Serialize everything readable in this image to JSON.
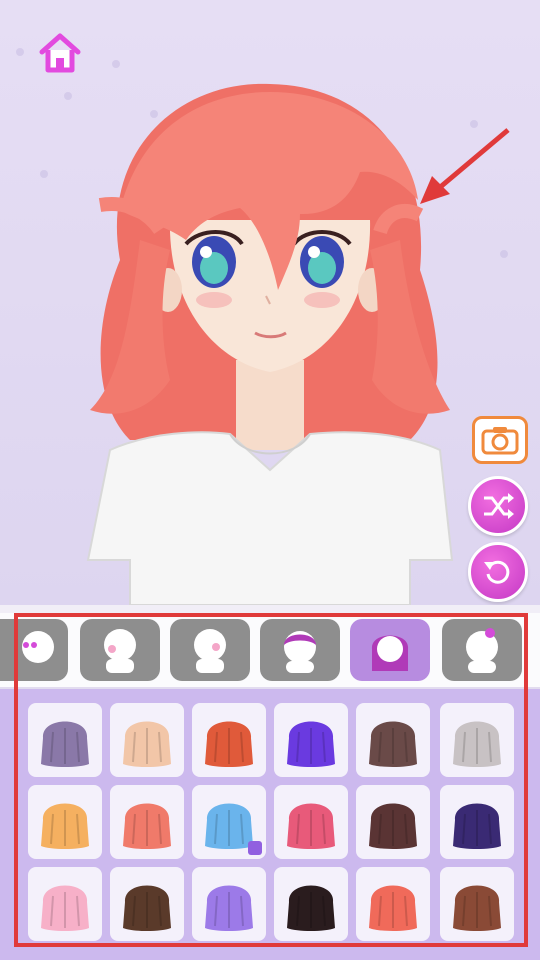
{
  "screen": {
    "home_button": {
      "icon": "home-icon"
    },
    "side_buttons": [
      {
        "name": "camera-button",
        "icon": "camera-icon"
      },
      {
        "name": "shuffle-button",
        "icon": "shuffle-icon"
      },
      {
        "name": "reset-button",
        "icon": "reset-icon"
      }
    ]
  },
  "category_tabs": [
    {
      "name": "tab-eyes",
      "active": false
    },
    {
      "name": "tab-blush",
      "active": false
    },
    {
      "name": "tab-face",
      "active": false
    },
    {
      "name": "tab-front-hair",
      "active": false
    },
    {
      "name": "tab-back-hair",
      "active": true
    },
    {
      "name": "tab-hair-accessory",
      "active": false
    }
  ],
  "hair_items": [
    {
      "color": "#8a78a8"
    },
    {
      "color": "#f2c6a8"
    },
    {
      "color": "#e05a3a"
    },
    {
      "color": "#6a3ae0"
    },
    {
      "color": "#6a4a48"
    },
    {
      "color": "#c8c2c4"
    },
    {
      "color": "#f5b060"
    },
    {
      "color": "#f07a6a"
    },
    {
      "color": "#6ab4ec",
      "badge": true
    },
    {
      "color": "#e85a7a"
    },
    {
      "color": "#5a3434"
    },
    {
      "color": "#3a2a74"
    },
    {
      "color": "#f7b0c8"
    },
    {
      "color": "#5a3a2a"
    },
    {
      "color": "#9c7ae8"
    },
    {
      "color": "#2a1c1e"
    },
    {
      "color": "#f06a5a"
    },
    {
      "color": "#8a4a36"
    }
  ],
  "colors": {
    "accent": "#b78ce0",
    "highlight": "#e03a3a",
    "hair": "#f2776c"
  }
}
